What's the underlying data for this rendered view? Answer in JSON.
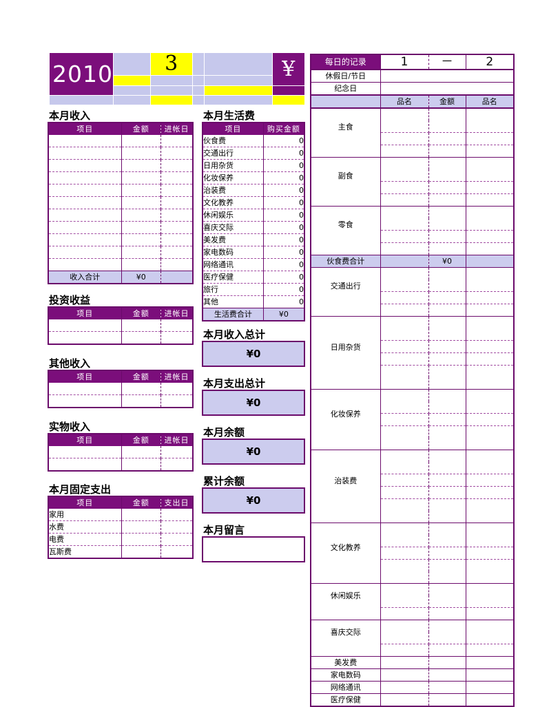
{
  "banner": {
    "year": "2010",
    "month": "3",
    "currency_symbol": "¥",
    "colors": {
      "purple": "#7B0E7B",
      "lavender": "#C6C8EC",
      "yellow": "#FFFF00"
    }
  },
  "income": {
    "title": "本月收入",
    "columns": [
      "项目",
      "金额",
      "进帐日"
    ],
    "rows": [
      [
        "",
        "",
        ""
      ],
      [
        "",
        "",
        ""
      ],
      [
        "",
        "",
        ""
      ],
      [
        "",
        "",
        ""
      ],
      [
        "",
        "",
        ""
      ],
      [
        "",
        "",
        ""
      ],
      [
        "",
        "",
        ""
      ],
      [
        "",
        "",
        ""
      ],
      [
        "",
        "",
        ""
      ],
      [
        "",
        "",
        ""
      ],
      [
        "",
        "",
        ""
      ]
    ],
    "total_label": "收入合计",
    "total_value": "¥0"
  },
  "investment": {
    "title": "投资收益",
    "columns": [
      "项目",
      "金额",
      "进帐日"
    ],
    "rows": [
      [
        "",
        "",
        ""
      ],
      [
        "",
        "",
        ""
      ]
    ]
  },
  "other_income": {
    "title": "其他收入",
    "columns": [
      "项目",
      "金额",
      "进帐日"
    ],
    "rows": [
      [
        "",
        "",
        ""
      ],
      [
        "",
        "",
        ""
      ]
    ]
  },
  "inkind_income": {
    "title": "实物收入",
    "columns": [
      "项目",
      "金额",
      "进帐日"
    ],
    "rows": [
      [
        "",
        "",
        ""
      ],
      [
        "",
        "",
        ""
      ]
    ]
  },
  "fixed_expense": {
    "title": "本月固定支出",
    "columns": [
      "项目",
      "金额",
      "支出日"
    ],
    "rows": [
      [
        "家用",
        "",
        ""
      ],
      [
        "水费",
        "",
        ""
      ],
      [
        "电费",
        "",
        ""
      ],
      [
        "瓦斯费",
        "",
        ""
      ]
    ]
  },
  "living_expense": {
    "title": "本月生活费",
    "columns": [
      "项目",
      "购买金额"
    ],
    "rows": [
      [
        "伙食费",
        "0"
      ],
      [
        "交通出行",
        "0"
      ],
      [
        "日用杂货",
        "0"
      ],
      [
        "化妆保养",
        "0"
      ],
      [
        "治装费",
        "0"
      ],
      [
        "文化教养",
        "0"
      ],
      [
        "休闲娱乐",
        "0"
      ],
      [
        "喜庆交际",
        "0"
      ],
      [
        "美发费",
        "0"
      ],
      [
        "家电数码",
        "0"
      ],
      [
        "网络通讯",
        "0"
      ],
      [
        "医疗保健",
        "0"
      ],
      [
        "旅行",
        "0"
      ],
      [
        "其他",
        "0"
      ]
    ],
    "total_label": "生活费合计",
    "total_value": "¥0"
  },
  "summaries": [
    {
      "label": "本月收入总计",
      "value": "¥0"
    },
    {
      "label": "本月支出总计",
      "value": "¥0"
    },
    {
      "label": "本月余额",
      "value": "¥0"
    },
    {
      "label": "累计余额",
      "value": "¥0"
    }
  ],
  "memo": {
    "label": "本月留言",
    "value": ""
  },
  "daily": {
    "title": "每日的记录",
    "day_headers": [
      "1",
      "一",
      "2"
    ],
    "meta_rows": [
      {
        "label": "休假日/节日",
        "values": [
          "",
          "",
          ""
        ]
      },
      {
        "label": "纪念日",
        "values": [
          "",
          "",
          ""
        ]
      }
    ],
    "sub_headers": [
      "品名",
      "金额",
      "品名"
    ],
    "categories": [
      {
        "label": "主食",
        "sub_rows": 3
      },
      {
        "label": "副食",
        "sub_rows": 3
      },
      {
        "label": "零食",
        "sub_rows": 3
      },
      {
        "label": "伙食费合计",
        "sub_rows": 0,
        "total": true,
        "total_value": "¥0"
      },
      {
        "label": "交通出行",
        "sub_rows": 3
      },
      {
        "label": "日用杂货",
        "sub_rows": 5
      },
      {
        "label": "化妆保养",
        "sub_rows": 4
      },
      {
        "label": "治装费",
        "sub_rows": 5
      },
      {
        "label": "文化教养",
        "sub_rows": 4
      },
      {
        "label": "休闲娱乐",
        "sub_rows": 2
      },
      {
        "label": "喜庆交际",
        "sub_rows": 2
      },
      {
        "label": "美发费",
        "sub_rows": 1
      },
      {
        "label": "家电数码",
        "sub_rows": 1
      },
      {
        "label": "网络通讯",
        "sub_rows": 1
      },
      {
        "label": "医疗保健",
        "sub_rows": 1
      }
    ]
  }
}
